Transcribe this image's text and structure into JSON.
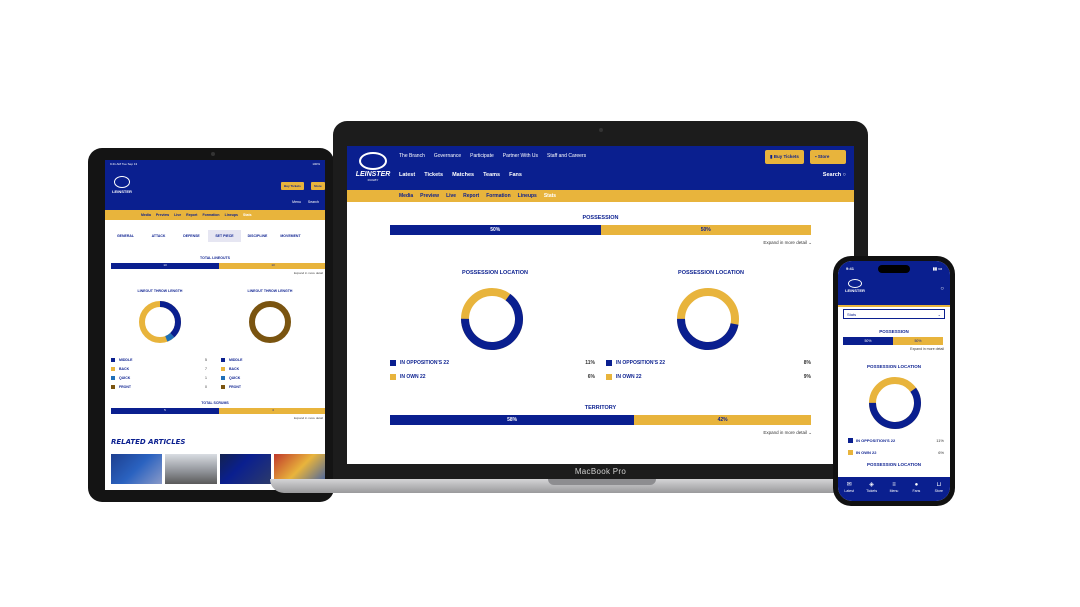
{
  "colors": {
    "navy": "#0a1f8f",
    "gold": "#e8b43c",
    "brown": "#7a5410",
    "teal": "#1e6fb8"
  },
  "tablet": {
    "status_left": "9:41 AM  Tue Sep 13",
    "status_right": "100%",
    "logo_text": "LEINSTER",
    "buy_button": "Buy Tickets",
    "store_button": "Store",
    "menu_label": "Menu",
    "search_label": "Search",
    "subnav": [
      "Media",
      "Preview",
      "Live",
      "Report",
      "Formation",
      "Lineups",
      "Stats"
    ],
    "tabs": [
      "GENERAL",
      "ATTACK",
      "DEFENSE",
      "SET PIECE",
      "DISCIPLINE",
      "MOVEMENT"
    ],
    "active_tab": "SET PIECE",
    "total_lineouts": {
      "label": "TOTAL LINEOUTS",
      "left": "13",
      "right": "13"
    },
    "expand": "Expand in more detail",
    "throw_chart_left": {
      "label": "LINEOUT THROW LENGTH"
    },
    "throw_chart_right": {
      "label": "LINEOUT THROW LENGTH"
    },
    "legend_left": [
      {
        "label": "MIDDLE",
        "value": "5",
        "color": "navy"
      },
      {
        "label": "BACK",
        "value": "7",
        "color": "gold"
      },
      {
        "label": "QUICK",
        "value": "1",
        "color": "teal"
      },
      {
        "label": "FRONT",
        "value": "0",
        "color": "brown"
      }
    ],
    "legend_right": [
      {
        "label": "MIDDLE",
        "color": "navy"
      },
      {
        "label": "BACK",
        "color": "gold"
      },
      {
        "label": "QUICK",
        "color": "teal"
      },
      {
        "label": "FRONT",
        "color": "brown"
      }
    ],
    "total_scrums": {
      "label": "TOTAL SCRUMS",
      "left": "5",
      "right": "4"
    },
    "related": "RELATED ARTICLES"
  },
  "laptop": {
    "brand": "MacBook Pro",
    "logo_text": "LEINSTER",
    "logo_sub": "RUGBY",
    "topnav": [
      "The Branch",
      "Governance",
      "Participate",
      "Partner With Us",
      "Staff and Careers"
    ],
    "mainnav": [
      "Latest",
      "Tickets",
      "Matches",
      "Teams",
      "Fans"
    ],
    "buy_button": "Buy Tickets",
    "store_button": "Store",
    "search": "Search",
    "subnav": [
      "Media",
      "Preview",
      "Live",
      "Report",
      "Formation",
      "Lineups",
      "Stats"
    ],
    "possession": {
      "label": "POSSESSION",
      "left": "50%",
      "right": "50%",
      "left_share": 50
    },
    "expand": "Expand in more detail",
    "loc_left": {
      "label": "POSSESSION LOCATION",
      "opp22": "11%",
      "own22": "6%",
      "navy_share": 0.65
    },
    "loc_right": {
      "label": "POSSESSION LOCATION",
      "opp22": "8%",
      "own22": "9%",
      "navy_share": 0.47
    },
    "legend_opp": "IN OPPOSITION'S 22",
    "legend_own": "IN OWN 22",
    "territory": {
      "label": "TERRITORY",
      "left": "58%",
      "right": "42%",
      "left_share": 58
    }
  },
  "phone": {
    "time": "9:41",
    "logo_text": "LEINSTER",
    "select": "Stats",
    "possession": {
      "label": "POSSESSION",
      "left": "50%",
      "right": "50%"
    },
    "expand": "Expand in more detail",
    "loc": {
      "label": "POSSESSION LOCATION",
      "opp22": "11%",
      "own22": "6%",
      "navy_share": 0.6
    },
    "legend_opp": "IN OPPOSITION'S 22",
    "legend_own": "IN OWN 22",
    "loc2_label": "POSSESSION LOCATION",
    "tabbar": [
      {
        "label": "Latest",
        "icon": "mail-icon"
      },
      {
        "label": "Tickets",
        "icon": "ticket-icon"
      },
      {
        "label": "Menu",
        "icon": "menu-icon"
      },
      {
        "label": "Fans",
        "icon": "person-icon"
      },
      {
        "label": "Store",
        "icon": "basket-icon"
      }
    ]
  }
}
